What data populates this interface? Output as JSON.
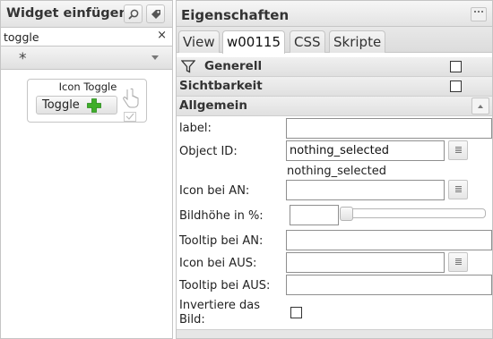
{
  "palette": {
    "panel_border": "#c5c5c5",
    "header_bg": "#e9e9e9",
    "plus_green": "#3fae2a"
  },
  "widget_panel": {
    "title": "Widget einfügen",
    "search_button_icon": "magnifier-icon",
    "tag_button_icon": "tag-icon",
    "search_value": "toggle",
    "clear_symbol": "×",
    "filter_value": "*",
    "widget": {
      "title": "Icon Toggle",
      "button_label": "Toggle",
      "button_icon": "plus-icon",
      "preview_icon": "hand-pointer-icon",
      "extra_icon": "checkmark-icon"
    }
  },
  "properties_panel": {
    "title": "Eigenschaften",
    "tabs": [
      {
        "label": "View",
        "active": false
      },
      {
        "label": "w00115",
        "active": true
      },
      {
        "label": "CSS",
        "active": false
      },
      {
        "label": "Skripte",
        "active": false
      }
    ],
    "sections": {
      "generell": {
        "label": "Generell",
        "icon": "filter-icon",
        "checked": false
      },
      "sichtbarkeit": {
        "label": "Sichtbarkeit",
        "checked": false
      },
      "allgemein": {
        "label": "Allgemein",
        "expanded": true
      }
    },
    "fields": {
      "label": {
        "label": "label:",
        "value": ""
      },
      "object_id": {
        "label": "Object ID:",
        "value": "nothing_selected",
        "hint": "nothing_selected"
      },
      "icon_an": {
        "label": "Icon bei AN:",
        "value": ""
      },
      "bildhoehe": {
        "label": "Bildhöhe in %:",
        "value": "",
        "slider_fraction": 0
      },
      "tooltip_an": {
        "label": "Tooltip bei AN:",
        "value": ""
      },
      "icon_aus": {
        "label": "Icon bei AUS:",
        "value": ""
      },
      "tooltip_aus": {
        "label": "Tooltip bei AUS:",
        "value": ""
      },
      "invertiere": {
        "label_line1": "Invertiere das",
        "label_line2": "Bild:",
        "checked": false
      }
    }
  }
}
